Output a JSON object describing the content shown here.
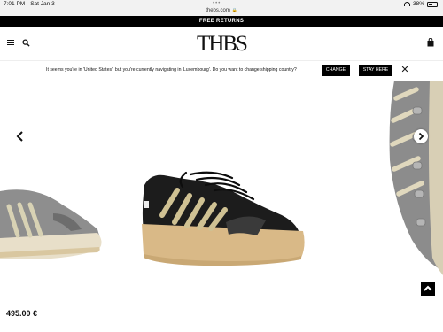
{
  "status_bar": {
    "time": "7:01 PM",
    "date": "Sat Jan 3",
    "url": "thebs.com",
    "battery": "38%"
  },
  "promo": {
    "text": "FREE RETURNS"
  },
  "header": {
    "logo": "THBS"
  },
  "location_banner": {
    "message": "It seems you're in 'United States', but you're currently navigating in 'Luxembourg'. Do you want to change shipping country?",
    "change_label": "CHANGE",
    "stay_label": "STAY HERE",
    "close_label": "✕"
  },
  "product": {
    "price": "495.00 €"
  },
  "colors": {
    "black": "#000000",
    "sole": "#d8b98a",
    "stripe_gold": "#cdbf8e",
    "gray_suede": "#8a8a8a"
  },
  "icons": {
    "menu": "hamburger-icon",
    "search": "search-icon",
    "bag": "shopping-bag-icon",
    "left": "chevron-left-icon",
    "right": "chevron-right-icon",
    "up": "chevron-up-icon",
    "close": "close-icon"
  }
}
